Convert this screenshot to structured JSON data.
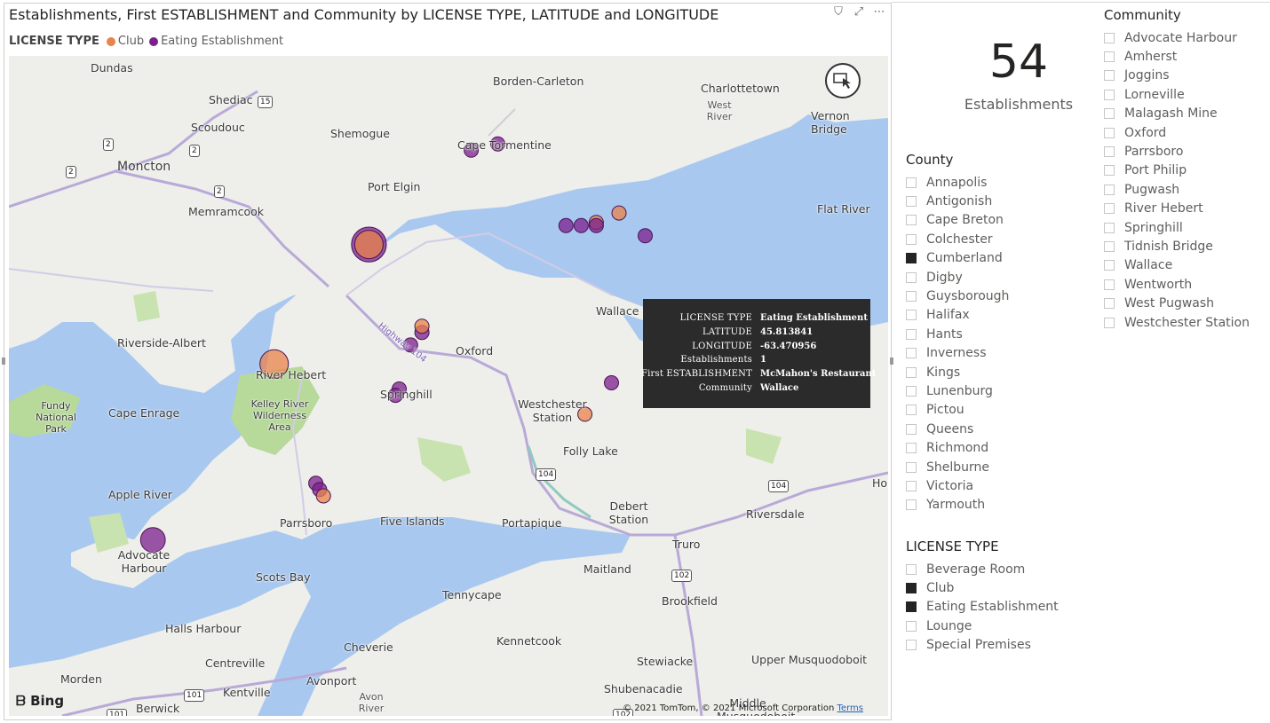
{
  "visual": {
    "title": "Establishments, First ESTABLISHMENT and Community by LICENSE TYPE, LATITUDE and LONGITUDE",
    "actions": [
      {
        "name": "filter-icon",
        "glyph": "⛉"
      },
      {
        "name": "focus-mode-icon",
        "glyph": "⤢"
      },
      {
        "name": "more-options-icon",
        "glyph": "⋯"
      }
    ]
  },
  "legend": {
    "title": "LICENSE TYPE",
    "items": [
      {
        "label": "Club",
        "color": "#e8834a"
      },
      {
        "label": "Eating Establishment",
        "color": "#7b1f8c"
      }
    ]
  },
  "map": {
    "places": [
      {
        "t": "Dundas"
      },
      {
        "t": "Shediac"
      },
      {
        "t": "Scoudouc"
      },
      {
        "t": "Moncton"
      },
      {
        "t": "Memramcook"
      },
      {
        "t": "Shemogue"
      },
      {
        "t": "Borden-Carleton"
      },
      {
        "t": "Cape Tormentine"
      },
      {
        "t": "Charlottetown"
      },
      {
        "t": "West River"
      },
      {
        "t": "Vernon Bridge"
      },
      {
        "t": "Port Elgin"
      },
      {
        "t": "Flat River"
      },
      {
        "t": "Riverside-Albert"
      },
      {
        "t": "Fundy National Park"
      },
      {
        "t": "Cape Enrage"
      },
      {
        "t": "River Hebert"
      },
      {
        "t": "Kelley River Wilderness Area"
      },
      {
        "t": "Springhill"
      },
      {
        "t": "Oxford"
      },
      {
        "t": "Westchester Station"
      },
      {
        "t": "Folly Lake"
      },
      {
        "t": "Wallace"
      },
      {
        "t": "Apple River"
      },
      {
        "t": "Parrsboro"
      },
      {
        "t": "Five Islands"
      },
      {
        "t": "Portapique"
      },
      {
        "t": "Debert Station"
      },
      {
        "t": "Riversdale"
      },
      {
        "t": "Truro"
      },
      {
        "t": "Advocate Harbour"
      },
      {
        "t": "Scots Bay"
      },
      {
        "t": "Maitland"
      },
      {
        "t": "Tennycape"
      },
      {
        "t": "Brookfield"
      },
      {
        "t": "Halls Harbour"
      },
      {
        "t": "Kennetcook"
      },
      {
        "t": "Cheverie"
      },
      {
        "t": "Centreville"
      },
      {
        "t": "Stewiacke"
      },
      {
        "t": "Upper Musquodoboit"
      },
      {
        "t": "Morden"
      },
      {
        "t": "Kentville"
      },
      {
        "t": "Avonport"
      },
      {
        "t": "Avon River"
      },
      {
        "t": "Shubenacadie"
      },
      {
        "t": "Middle Musquodoboit"
      },
      {
        "t": "Berwick"
      },
      {
        "t": "Highway 104"
      },
      {
        "t": "Hop"
      }
    ],
    "shields": [
      "15",
      "2",
      "2",
      "2",
      "2",
      "104",
      "104",
      "102",
      "101",
      "101",
      "102"
    ],
    "points": [
      {
        "type": "Eating Establishment",
        "lat": 45.8,
        "lon": -64.2,
        "count": 6
      },
      {
        "type": "Club",
        "lat": 45.8,
        "lon": -64.2,
        "count": 4
      },
      {
        "type": "Club",
        "lat": 45.61,
        "lon": -64.45,
        "count": 4
      },
      {
        "type": "Eating Establishment",
        "lat": 45.95,
        "lon": -63.93,
        "count": 1
      },
      {
        "type": "Eating Establishment",
        "lat": 45.96,
        "lon": -63.86,
        "count": 1
      },
      {
        "type": "Eating Establishment",
        "lat": 45.83,
        "lon": -63.68,
        "count": 1
      },
      {
        "type": "Eating Establishment",
        "lat": 45.83,
        "lon": -63.64,
        "count": 1
      },
      {
        "type": "Club",
        "lat": 45.835,
        "lon": -63.6,
        "count": 1
      },
      {
        "type": "Eating Establishment",
        "lat": 45.83,
        "lon": -63.6,
        "count": 1
      },
      {
        "type": "Club",
        "lat": 45.85,
        "lon": -63.54,
        "count": 1
      },
      {
        "type": "Eating Establishment",
        "lat": 45.813841,
        "lon": -63.470956,
        "count": 1
      },
      {
        "type": "Eating Establishment",
        "lat": 45.64,
        "lon": -64.09,
        "count": 1
      },
      {
        "type": "Eating Establishment",
        "lat": 45.66,
        "lon": -64.06,
        "count": 1
      },
      {
        "type": "Club",
        "lat": 45.67,
        "lon": -64.06,
        "count": 1
      },
      {
        "type": "Eating Establishment",
        "lat": 45.57,
        "lon": -64.12,
        "count": 1
      },
      {
        "type": "Eating Establishment",
        "lat": 45.56,
        "lon": -64.13,
        "count": 1
      },
      {
        "type": "Eating Establishment",
        "lat": 45.58,
        "lon": -63.56,
        "count": 1
      },
      {
        "type": "Club",
        "lat": 45.53,
        "lon": -63.63,
        "count": 1
      },
      {
        "type": "Eating Establishment",
        "lat": 45.42,
        "lon": -64.34,
        "count": 1
      },
      {
        "type": "Eating Establishment",
        "lat": 45.41,
        "lon": -64.33,
        "count": 1
      },
      {
        "type": "Club",
        "lat": 45.4,
        "lon": -64.32,
        "count": 1
      },
      {
        "type": "Eating Establishment",
        "lat": 45.33,
        "lon": -64.77,
        "count": 3
      }
    ],
    "bing_label": "Bing",
    "copyright": "© 2021 TomTom, © 2021 Microsoft Corporation",
    "terms": "Terms"
  },
  "tooltip": [
    {
      "k": "LICENSE TYPE",
      "v": "Eating Establishment"
    },
    {
      "k": "LATITUDE",
      "v": "45.813841"
    },
    {
      "k": "LONGITUDE",
      "v": "-63.470956"
    },
    {
      "k": "Establishments",
      "v": "1"
    },
    {
      "k": "First ESTABLISHMENT",
      "v": "McMahon's Restaurant"
    },
    {
      "k": "Community",
      "v": "Wallace"
    }
  ],
  "card": {
    "value": "54",
    "label": "Establishments"
  },
  "county": {
    "title": "County",
    "items": [
      {
        "label": "Annapolis",
        "checked": false
      },
      {
        "label": "Antigonish",
        "checked": false
      },
      {
        "label": "Cape Breton",
        "checked": false
      },
      {
        "label": "Colchester",
        "checked": false
      },
      {
        "label": "Cumberland",
        "checked": true
      },
      {
        "label": "Digby",
        "checked": false
      },
      {
        "label": "Guysborough",
        "checked": false
      },
      {
        "label": "Halifax",
        "checked": false
      },
      {
        "label": "Hants",
        "checked": false
      },
      {
        "label": "Inverness",
        "checked": false
      },
      {
        "label": "Kings",
        "checked": false
      },
      {
        "label": "Lunenburg",
        "checked": false
      },
      {
        "label": "Pictou",
        "checked": false
      },
      {
        "label": "Queens",
        "checked": false
      },
      {
        "label": "Richmond",
        "checked": false
      },
      {
        "label": "Shelburne",
        "checked": false
      },
      {
        "label": "Victoria",
        "checked": false
      },
      {
        "label": "Yarmouth",
        "checked": false
      }
    ]
  },
  "license": {
    "title": "LICENSE TYPE",
    "items": [
      {
        "label": "Beverage Room",
        "checked": false
      },
      {
        "label": "Club",
        "checked": true
      },
      {
        "label": "Eating Establishment",
        "checked": true
      },
      {
        "label": "Lounge",
        "checked": false
      },
      {
        "label": "Special Premises",
        "checked": false
      }
    ]
  },
  "community": {
    "title": "Community",
    "items": [
      {
        "label": "Advocate Harbour",
        "checked": false
      },
      {
        "label": "Amherst",
        "checked": false
      },
      {
        "label": "Joggins",
        "checked": false
      },
      {
        "label": "Lorneville",
        "checked": false
      },
      {
        "label": "Malagash Mine",
        "checked": false
      },
      {
        "label": "Oxford",
        "checked": false
      },
      {
        "label": "Parrsboro",
        "checked": false
      },
      {
        "label": "Port Philip",
        "checked": false
      },
      {
        "label": "Pugwash",
        "checked": false
      },
      {
        "label": "River Hebert",
        "checked": false
      },
      {
        "label": "Springhill",
        "checked": false
      },
      {
        "label": "Tidnish Bridge",
        "checked": false
      },
      {
        "label": "Wallace",
        "checked": false
      },
      {
        "label": "Wentworth",
        "checked": false
      },
      {
        "label": "West Pugwash",
        "checked": false
      },
      {
        "label": "Westchester Station",
        "checked": false
      }
    ]
  }
}
